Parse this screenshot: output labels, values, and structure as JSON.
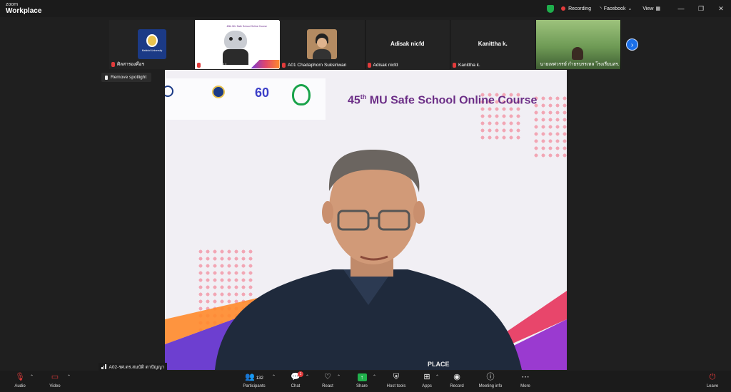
{
  "app": {
    "brand_top": "zoom",
    "brand_bottom": "Workplace"
  },
  "titlebar": {
    "recording_label": "Recording",
    "facebook_label": "Facebook",
    "view_label": "View",
    "minimize": "—",
    "restore": "❐",
    "close": "✕"
  },
  "participants_strip": [
    {
      "name": "ศิลสารองคือร",
      "muted": true,
      "kind": "logo",
      "logo_text": "Mahidol University"
    },
    {
      "name": "N.CFD. MU",
      "muted": true,
      "kind": "slide",
      "thumb_title": "45th MU Safe School Online Course"
    },
    {
      "name": "A01 Chadaphorn Suksiriwan",
      "muted": true,
      "kind": "photo"
    },
    {
      "name": "Adisak nicfd",
      "muted": true,
      "kind": "name",
      "center_name": "Adisak nicfd"
    },
    {
      "name": "Kanittha k.",
      "muted": true,
      "kind": "name",
      "center_name": "Kanittha k."
    },
    {
      "name": "นายเทศวรรษ์ กำธรบรรเทล โรงเรียนสร...",
      "muted": true,
      "kind": "video"
    }
  ],
  "strip_next": "›",
  "spotlight": {
    "label": "Remove spotlight"
  },
  "main_video": {
    "slide_title_number": "45",
    "slide_title_sup": "th",
    "slide_title_rest": " MU Safe School Online Course",
    "logo_60": "60",
    "shirt_text": "PLACE",
    "speaker_label": "A02-รศ.ดร.สมบัติ ตาปัญญา"
  },
  "toolbar": {
    "audio": "Audio",
    "video": "Video",
    "participants": "Participants",
    "participants_count": "132",
    "chat": "Chat",
    "chat_badge": "1",
    "react": "React",
    "share": "Share",
    "host_tools": "Host tools",
    "apps": "Apps",
    "record": "Record",
    "meeting_info": "Meeting info",
    "more": "More",
    "leave": "Leave"
  },
  "colors": {
    "accent_blue": "#1a6fe8",
    "recording_red": "#e23b3b",
    "share_green": "#21b14c",
    "slide_purple": "#6b2d86"
  }
}
